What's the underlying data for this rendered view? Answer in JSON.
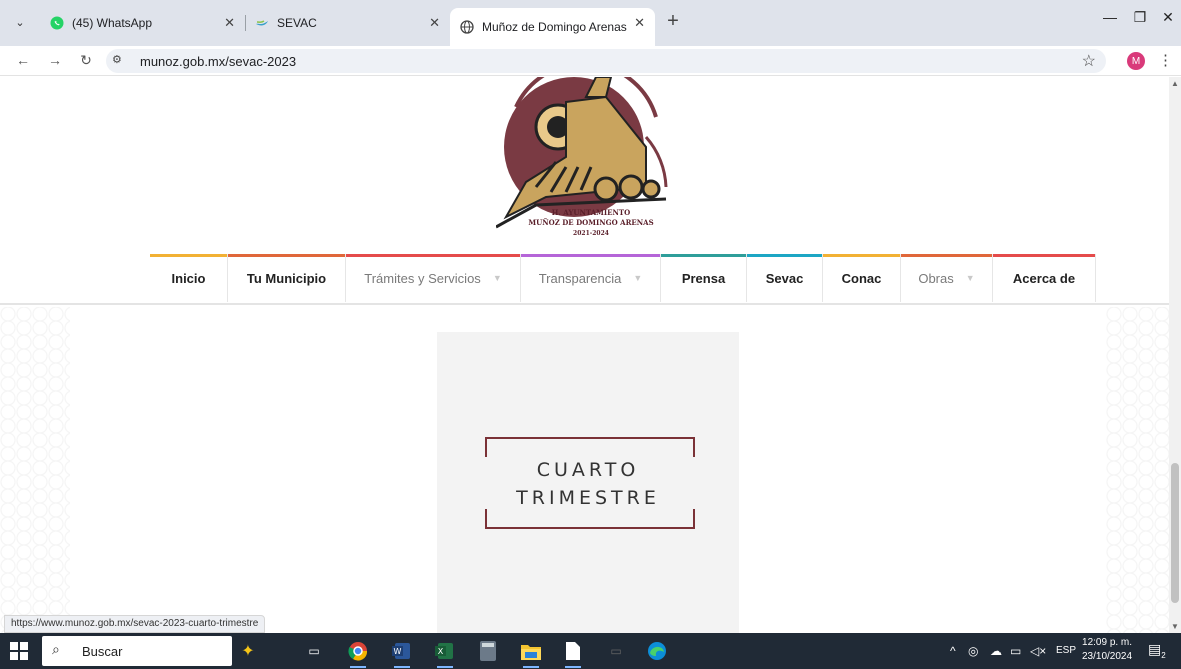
{
  "browser": {
    "tabs": [
      {
        "title": "(45) WhatsApp",
        "icon": "whatsapp-icon"
      },
      {
        "title": "SEVAC",
        "icon": "sevac-icon"
      },
      {
        "title": "Muñoz de Domingo Arenas",
        "icon": "globe-icon",
        "active": true
      }
    ],
    "url": "munoz.gob.mx/sevac-2023",
    "avatar_letter": "M"
  },
  "site": {
    "logo_text": [
      "H. AYUNTAMIENTO",
      "MUÑOZ DE DOMINGO ARENAS",
      "2021-2024"
    ],
    "menu": [
      {
        "label": "Inicio",
        "color": "#f2b134"
      },
      {
        "label": "Tu Municipio",
        "color": "#e0673a"
      },
      {
        "label": "Trámites y Servicios",
        "color": "#e54b4b"
      },
      {
        "label": "Transparencia",
        "color": "#b565d8"
      },
      {
        "label": "Prensa",
        "color": "#2e9e9a"
      },
      {
        "label": "Sevac",
        "color": "#1da6c4"
      },
      {
        "label": "Conac",
        "color": "#f2b134"
      },
      {
        "label": "Obras",
        "color": "#e0673a"
      },
      {
        "label": "Acerca de",
        "color": "#e54b4b"
      }
    ]
  },
  "card": {
    "line1": "CUARTO",
    "line2": "TRIMESTRE",
    "frame_color": "#7a3136"
  },
  "status_url": "https://www.munoz.gob.mx/sevac-2023-cuarto-trimestre",
  "taskbar": {
    "search_placeholder": "Buscar",
    "language": "ESP",
    "time": "12:09 p. m.",
    "date": "23/10/2024",
    "notification_count": "2"
  }
}
